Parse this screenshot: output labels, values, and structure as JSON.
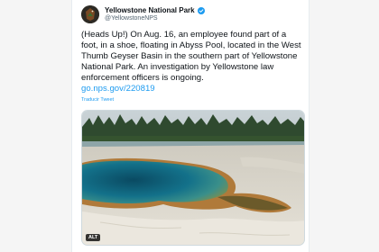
{
  "account": {
    "display_name": "Yellowstone National Park",
    "handle": "@YellowstoneNPS",
    "verified": true,
    "avatar_icon": "nps-arrowhead-logo"
  },
  "tweet": {
    "text": "(Heads Up!) On Aug. 16, an employee found part of a foot, in a shoe, floating in Abyss Pool, located in the West Thumb Geyser Basin in the southern part of Yellowstone National Park. An investigation by Yellowstone law enforcement officers is ongoing.",
    "link": "go.nps.gov/220819",
    "translate_label": "Traducir Tweet"
  },
  "media": {
    "alt_label": "ALT"
  },
  "colors": {
    "link": "#1d9bf0",
    "verified": "#1d9bf0",
    "text": "#0f1419",
    "secondary": "#536471"
  }
}
